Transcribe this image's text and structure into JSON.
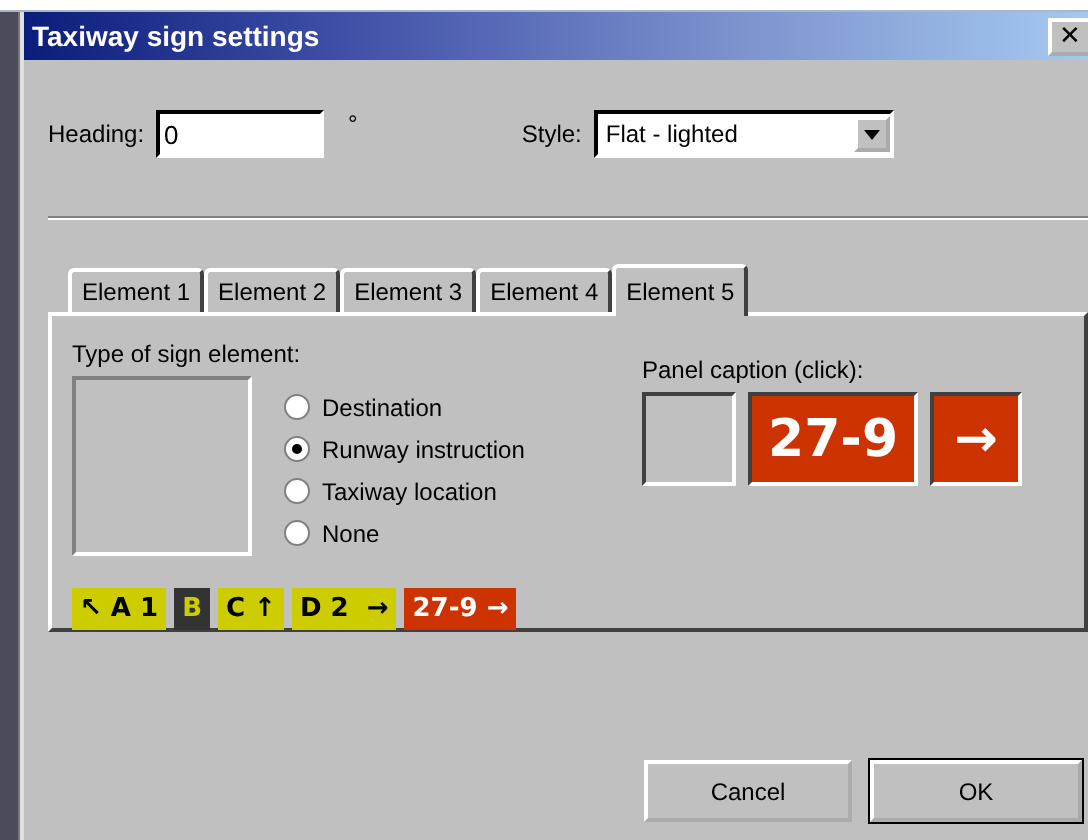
{
  "window": {
    "title": "Taxiway sign settings",
    "close": "✕"
  },
  "heading": {
    "label": "Heading:",
    "value": "0",
    "unit": "°"
  },
  "style": {
    "label": "Style:",
    "value": "Flat - lighted"
  },
  "tabs": [
    {
      "label": "Element 1",
      "selected": false
    },
    {
      "label": "Element 2",
      "selected": false
    },
    {
      "label": "Element 3",
      "selected": false
    },
    {
      "label": "Element 4",
      "selected": false
    },
    {
      "label": "Element 5",
      "selected": true
    }
  ],
  "type_group": {
    "label": "Type of sign element:",
    "options": [
      {
        "label": "Destination",
        "selected": false
      },
      {
        "label": "Runway instruction",
        "selected": true
      },
      {
        "label": "Taxiway location",
        "selected": false
      },
      {
        "label": "None",
        "selected": false
      }
    ]
  },
  "panel_caption": {
    "label": "Panel caption (click):",
    "cells": [
      {
        "kind": "empty"
      },
      {
        "kind": "runway",
        "text": "27-9"
      },
      {
        "kind": "runway",
        "text": "→"
      }
    ]
  },
  "sign_preview": [
    {
      "kind": "direction",
      "text": "↖ A 1"
    },
    {
      "kind": "location",
      "text": "B"
    },
    {
      "kind": "direction",
      "text": "C ↑"
    },
    {
      "kind": "direction",
      "text": "D 2  →"
    },
    {
      "kind": "runway",
      "text": "27-9 →"
    }
  ],
  "buttons": [
    {
      "label": "Cancel",
      "default": false
    },
    {
      "label": "OK",
      "default": true
    }
  ]
}
